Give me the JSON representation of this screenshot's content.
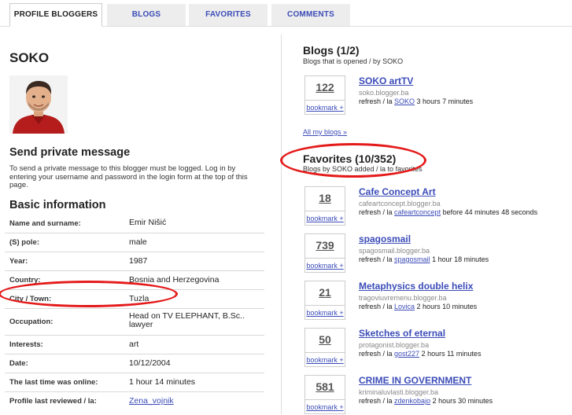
{
  "tabs": [
    "PROFILE BLOGGERS",
    "BLOGS",
    "FAVORITES",
    "COMMENTS"
  ],
  "profile": {
    "name": "SOKO",
    "send_title": "Send private message",
    "send_text": "To send a private message to this blogger must be logged. Log in by entering your username and password in the login form at the top of this page.",
    "basic_title": "Basic information",
    "rows": [
      {
        "label": "Name and surname:",
        "value": "Emir Nišić"
      },
      {
        "label": "(S) pole:",
        "value": "male"
      },
      {
        "label": "Year:",
        "value": "1987"
      },
      {
        "label": "Country:",
        "value": "Bosnia and Herzegovina"
      },
      {
        "label": "City / Town:",
        "value": "Tuzla"
      },
      {
        "label": "Occupation:",
        "value": "Head on TV ELEPHANT, B.Sc.. lawyer"
      },
      {
        "label": "Interests:",
        "value": "art"
      },
      {
        "label": "Date:",
        "value": "10/12/2004"
      },
      {
        "label": "The last time was online:",
        "value": "1 hour 14 minutes"
      },
      {
        "label": "Profile last reviewed / la:",
        "value": "Zena_vojnik"
      }
    ]
  },
  "blogs": {
    "title": "Blogs (1/2)",
    "subtitle": "Blogs that is opened / by SOKO",
    "items": [
      {
        "count": "122",
        "name": "SOKO artTV",
        "url": "soko.blogger.ba",
        "meta_pre": "refresh / la ",
        "user": "SOKO",
        "time": " 3 hours 7 minutes"
      }
    ],
    "all_link": "All my blogs »",
    "bookmark": "bookmark +"
  },
  "favorites": {
    "title": "Favorites (10/352)",
    "subtitle": "Blogs by SOKO added / la to favorites",
    "items": [
      {
        "count": "18",
        "name": "Cafe Concept Art",
        "url": "cafeartconcept.blogger.ba",
        "meta_pre": "refresh / la ",
        "user": "cafeartconcept",
        "time": " before 44 minutes 48 seconds"
      },
      {
        "count": "739",
        "name": "spagosmail",
        "url": "spagosmail.blogger.ba",
        "meta_pre": "refresh / la ",
        "user": "spagosmail",
        "time": " 1 hour 18 minutes"
      },
      {
        "count": "21",
        "name": "Metaphysics double helix",
        "url": "tragoviuvremenu.blogger.ba",
        "meta_pre": "refresh / la ",
        "user": "Lovica",
        "time": " 2 hours 10 minutes"
      },
      {
        "count": "50",
        "name": "Sketches of eternal",
        "url": "protagonist.blogger.ba",
        "meta_pre": "refresh / la ",
        "user": "gost227",
        "time": " 2 hours 11 minutes"
      },
      {
        "count": "581",
        "name": "CRIME IN GOVERNMENT",
        "url": "kriminaluvlasti.blogger.ba",
        "meta_pre": "refresh / la ",
        "user": "zdenkobajo",
        "time": " 2 hours 30 minutes"
      }
    ]
  },
  "colors": {
    "link": "#3b4cb8",
    "highlight": "#e41a1a"
  }
}
